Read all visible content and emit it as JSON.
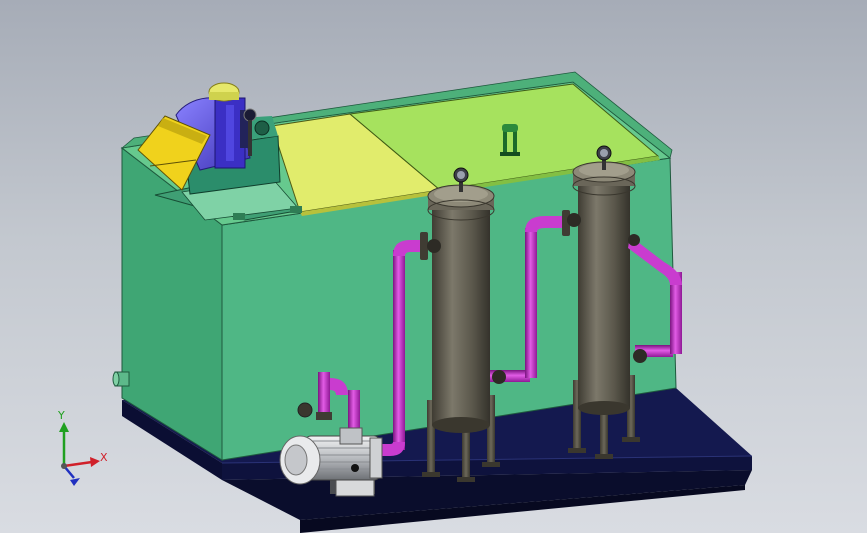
{
  "view": {
    "triad": {
      "x_label": "X",
      "y_label": "Y",
      "x_color": "#d0202a",
      "y_color": "#20a020",
      "z_color": "#2030c0"
    }
  },
  "colors": {
    "background_top": "#a6acb7",
    "background_bottom": "#d9dce2",
    "tank_front": "#4fb785",
    "tank_side": "#3fa674",
    "tank_top": "#66c98e",
    "base_plate": "#14194f",
    "lid_left": "#e1ec6c",
    "lid_right": "#a6e25e",
    "pipe": "#b020b8",
    "filter_housing": "#5d5a4e",
    "motor": "#cfd1d4",
    "chute": "#f0d21c",
    "hopper": "#6b5fe8"
  }
}
